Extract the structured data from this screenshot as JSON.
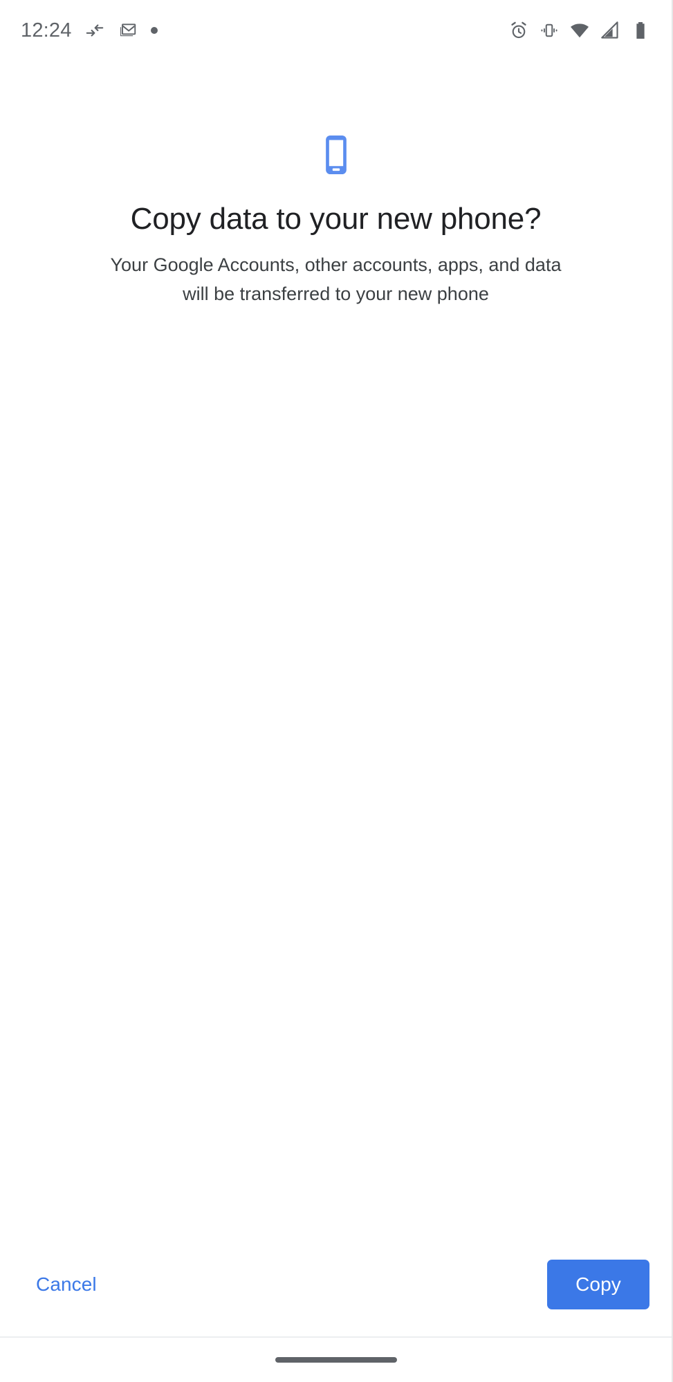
{
  "status_bar": {
    "clock": "12:24",
    "left_icons": [
      {
        "name": "data-transfer-icon",
        "label": "data transfer"
      },
      {
        "name": "gmail-icon",
        "label": "Gmail"
      },
      {
        "name": "notification-dot-icon",
        "label": "notification"
      }
    ],
    "right_icons": [
      {
        "name": "alarm-icon",
        "label": "alarm set"
      },
      {
        "name": "vibrate-icon",
        "label": "ringer vibrate"
      },
      {
        "name": "wifi-icon",
        "label": "wifi"
      },
      {
        "name": "cellular-signal-icon",
        "label": "cellular signal"
      },
      {
        "name": "battery-icon",
        "label": "battery full"
      }
    ],
    "icon_color": "#5f6368"
  },
  "main": {
    "hero_icon": "smartphone-icon",
    "title": "Copy data to your new phone?",
    "subtitle": "Your Google Accounts, other accounts, apps, and data will be transferred to your new phone"
  },
  "buttons": {
    "cancel_label": "Cancel",
    "copy_label": "Copy"
  },
  "nav_bar": {
    "gesture_pill": "home-gesture-pill"
  },
  "colors": {
    "accent_blue": "#3b78e7",
    "hero_blue": "#5b8def",
    "title_text": "#202124",
    "body_text": "#3c4043",
    "background": "#ffffff",
    "system_gray": "#5f6368"
  }
}
